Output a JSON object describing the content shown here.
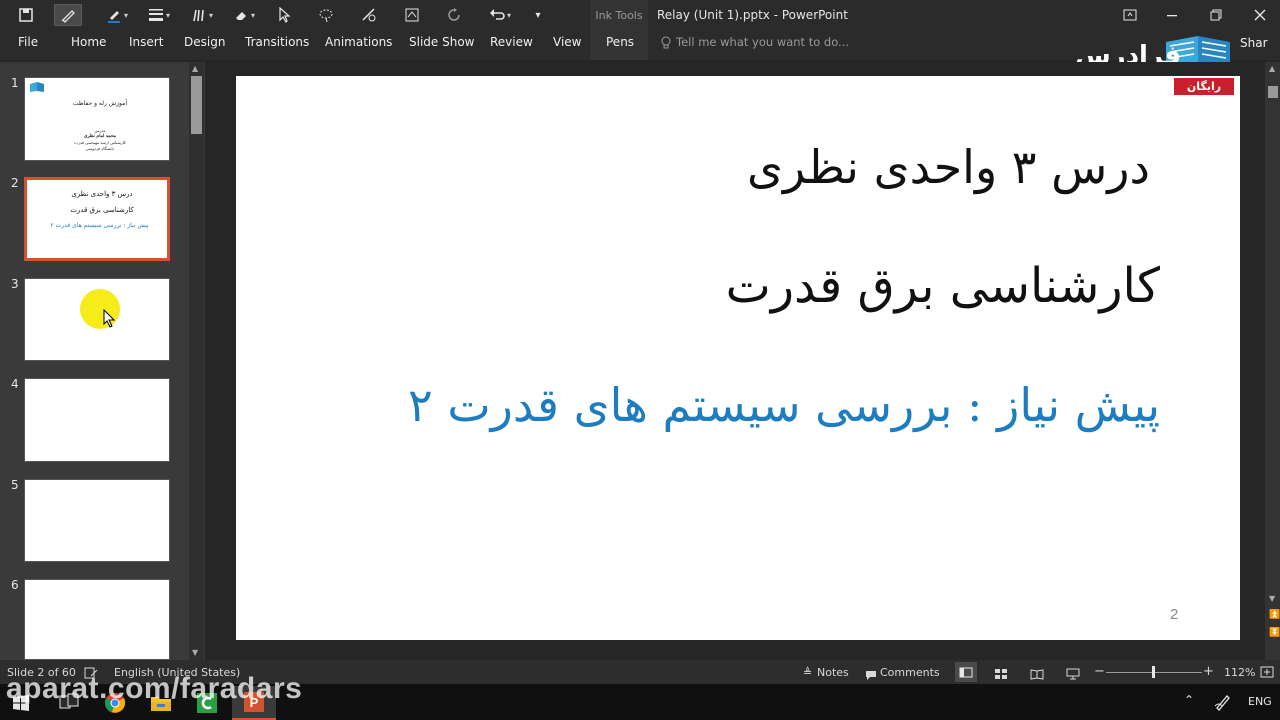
{
  "app": {
    "window_title": "Relay (Unit 1).pptx - PowerPoint",
    "context_tab_group": "Ink Tools"
  },
  "ribbon": {
    "tabs": [
      "File",
      "Home",
      "Insert",
      "Design",
      "Transitions",
      "Animations",
      "Slide Show",
      "Review",
      "View",
      "Pens"
    ],
    "active_tab": "Pens",
    "tell_me_placeholder": "Tell me what you want to do...",
    "share_label": "Share"
  },
  "brand": {
    "logo_text": "فرادرس",
    "badge": "رایگان",
    "badge_color": "#c8202c"
  },
  "thumbnails": {
    "numbers": [
      "1",
      "2",
      "3",
      "4",
      "5",
      "6"
    ],
    "active_index": 2,
    "slide1_lines": [
      "آموزش رله و حفاظت",
      "مدرس",
      "محمد امام نظری",
      "کارشناس ارشد مهندسی قدرت",
      "دانشگاه فردوسی"
    ],
    "slide2_lines": [
      "درس ۳ واحدی نظری",
      "کارشناسی برق قدرت",
      "پیش نیاز : بررسی سیستم های قدرت ۲"
    ]
  },
  "slide": {
    "line1": "درس ۳ واحدی نظری",
    "line2": "کارشناسی برق قدرت",
    "line3": "پیش نیاز : بررسی سیستم های قدرت ۲",
    "page_number": "2",
    "ink_blue": "#1e7cc1",
    "ink_black": "#111111"
  },
  "status_bar": {
    "slide_indicator": "Slide 2 of 60",
    "language": "English (United States)",
    "notes_label": "Notes",
    "comments_label": "Comments",
    "zoom": "112%"
  },
  "taskbar": {
    "language": "ENG",
    "watermark": "aparat.com/faradars"
  }
}
